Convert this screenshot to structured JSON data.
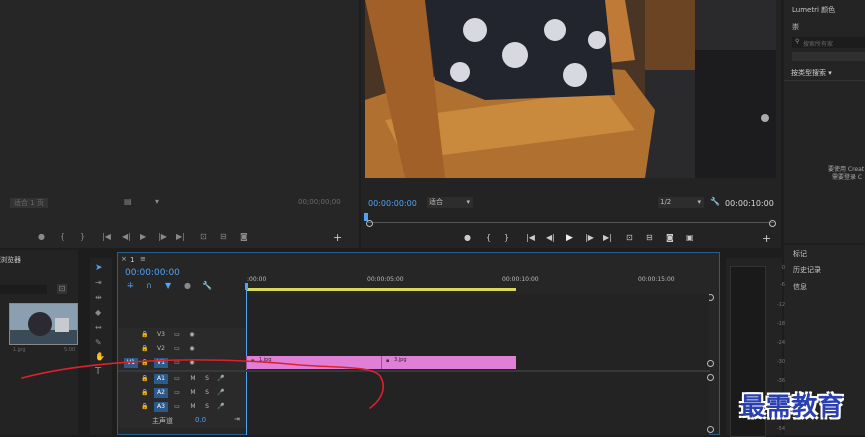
{
  "source_monitor": {
    "dropdown_value": "适合 1 页",
    "timecode": "00;00;00;00",
    "controls": [
      "marker-icon",
      "mark-in-icon",
      "mark-out-icon",
      "go-to-in-icon",
      "step-back-icon",
      "play-icon",
      "step-forward-icon",
      "go-to-out-icon",
      "insert-icon",
      "overwrite-icon",
      "export-frame-icon"
    ]
  },
  "program_monitor": {
    "timecode_current": "00:00:00:00",
    "fit_value": "适合",
    "resolution_value": "1/2",
    "timecode_duration": "00:00:10:00"
  },
  "lumetri": {
    "title": "Lumetri 颜色",
    "subtitle": "崇",
    "search_placeholder": "搜索所有家",
    "filter_label": "按类型搜索",
    "hint_line1": "要使用 Creat",
    "hint_line2": "需要登录 C"
  },
  "right_tabs": [
    "标记",
    "历史记录",
    "信息"
  ],
  "project": {
    "title": "浏览器",
    "clip_name": "1.jpg",
    "clip_duration": "5:00"
  },
  "timeline": {
    "sequence_name": "1",
    "timecode": "00:00:00:00",
    "ruler_labels": [
      ":00:00",
      "00:00:05:00",
      "00:00:10:00",
      "00:00:15:00"
    ],
    "tracks_video": [
      {
        "name": "V3",
        "target": ""
      },
      {
        "name": "V2",
        "target": ""
      },
      {
        "name": "V1",
        "target": "V1"
      }
    ],
    "tracks_audio": [
      {
        "name": "A1",
        "m": "M",
        "s": "S"
      },
      {
        "name": "A2",
        "m": "M",
        "s": "S"
      },
      {
        "name": "A3",
        "m": "M",
        "s": "S"
      }
    ],
    "master_label": "主声道",
    "master_value": "0.0",
    "clips": [
      {
        "name": "1.jpg",
        "start": 0,
        "end": 5
      },
      {
        "name": "3.jpg",
        "start": 5,
        "end": 10
      }
    ],
    "work_area_end_seconds": 10
  },
  "meter": {
    "labels": [
      "0",
      "-6",
      "-12",
      "-18",
      "-24",
      "-30",
      "-36",
      "-42",
      "-48",
      "-54"
    ]
  },
  "watermark": "最需教育",
  "colors": {
    "accent": "#4fa3f7",
    "clip": "#e07fd6",
    "annotation": "#e0202c"
  }
}
